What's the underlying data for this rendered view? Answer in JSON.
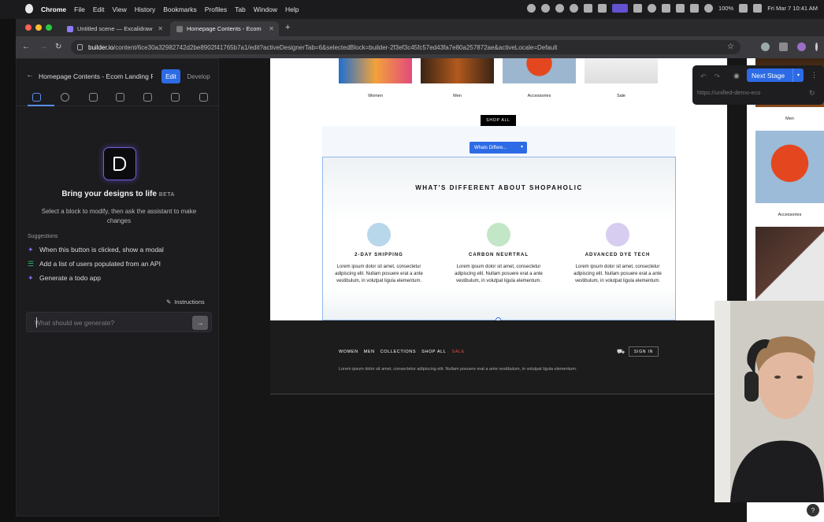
{
  "menubar": {
    "app": "Chrome",
    "menus": [
      "File",
      "Edit",
      "View",
      "History",
      "Bookmarks",
      "Profiles",
      "Tab",
      "Window",
      "Help"
    ],
    "battery": "100%",
    "datetime": "Fri Mar 7  10:41 AM"
  },
  "tabs": [
    {
      "title": "Untitled scene — Excalidraw"
    },
    {
      "title": "Homepage Contents - Ecom"
    }
  ],
  "address": {
    "domain": "builder.io",
    "path": "/content/6ce30a32982742d2be8902f41765b7a1/edit?activeDesignerTab=6&selectedBlock=builder-2f3ef3c45fc57ed43fa7e80a257872ae&activeLocale=Default"
  },
  "editor": {
    "page_title": "Homepage Contents - Ecom Landing F",
    "edit_label": "Edit",
    "develop_label": "Develop",
    "heading": "Bring your designs to life",
    "beta": "BETA",
    "subtitle": "Select a block to modify, then ask the assistant to make changes",
    "suggestions_label": "Suggestions",
    "suggestions": [
      "When this button is clicked, show a modal",
      "Add a list of users populated from an API",
      "Generate a todo app"
    ],
    "instructions_label": "Instructions",
    "prompt_placeholder": "What should we generate?"
  },
  "page": {
    "categories": [
      "Women",
      "Men",
      "Accessories",
      "Sale"
    ],
    "shop_all": "SHOP ALL",
    "selected_chip": "Whats Differe...",
    "section_title": "WHAT'S DIFFERENT ABOUT SHOPAHOLIC",
    "features": [
      {
        "title": "2-DAY SHIPPING",
        "body": "Lorem ipsum dolor sit amet, consectetur adipiscing elit. Nullam posuere erat a ante vestibulum, in volutpat ligula elementum.",
        "color": "#b9d7ea"
      },
      {
        "title": "CARBON NEURTRAL",
        "body": "Lorem ipsum dolor sit amet, consectetur adipiscing elit. Nullam posuere erat a ante vestibulum, in volutpat ligula elementum.",
        "color": "#c3e6c6"
      },
      {
        "title": "ADVANCED DYE TECH",
        "body": "Lorem ipsum dolor sit amet, consectetur adipiscing elit. Nullam posuere erat a ante vestibulum, in volutpat ligula elementum.",
        "color": "#d7cdf0"
      }
    ],
    "footer_nav": [
      "WOMEN",
      "MEN",
      "COLLECTIONS",
      "SHOP ALL",
      "SALE"
    ],
    "sign_in": "SIGN IN",
    "footer_text": "Lorem ipsum dolor sit amet, consectetur adipiscing elit. Nullam posuere erat a ante vestibulum, in volutpat ligula elementum."
  },
  "stage": {
    "next_stage": "Next Stage",
    "url": "https://unified-demo-eco"
  },
  "preview": {
    "labels": [
      "Men",
      "Accessories"
    ]
  },
  "colors": {
    "accent": "#2d6be6",
    "sale": "#e34a4a"
  }
}
